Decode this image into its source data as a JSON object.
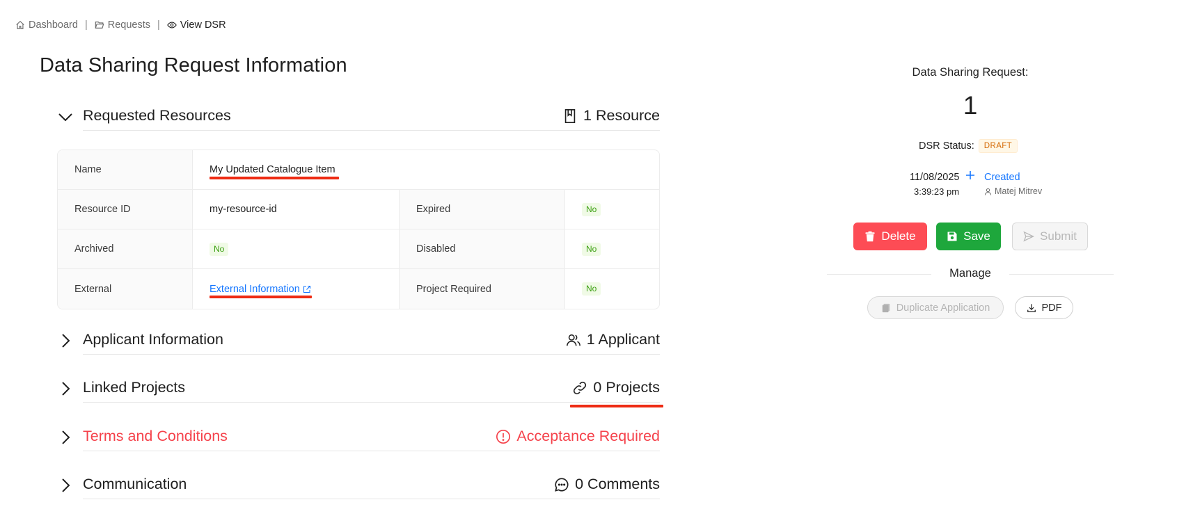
{
  "breadcrumb": {
    "items": [
      {
        "label": "Dashboard",
        "icon": "home-icon"
      },
      {
        "label": "Requests",
        "icon": "folder-open-icon"
      },
      {
        "label": "View DSR",
        "icon": "eye-icon"
      }
    ],
    "separator": "|"
  },
  "page_title": "Data Sharing Request Information",
  "sections": {
    "requested_resources": {
      "title": "Requested Resources",
      "summary": "1 Resource",
      "icon": "book-icon",
      "expanded": true
    },
    "applicant_information": {
      "title": "Applicant Information",
      "summary": "1 Applicant",
      "icon": "users-icon"
    },
    "linked_projects": {
      "title": "Linked Projects",
      "summary": "0 Projects",
      "icon": "link-icon"
    },
    "terms_and_conditions": {
      "title": "Terms and Conditions",
      "summary": "Acceptance Required",
      "icon": "exclamation-circle-icon",
      "color": "#f5424b"
    },
    "communication": {
      "title": "Communication",
      "summary": "0 Comments",
      "icon": "comment-icon"
    }
  },
  "resource_table": {
    "name_label": "Name",
    "name_value": "My Updated Catalogue Item",
    "resource_id_label": "Resource ID",
    "resource_id_value": "my-resource-id",
    "expired_label": "Expired",
    "expired_value": "No",
    "archived_label": "Archived",
    "archived_value": "No",
    "disabled_label": "Disabled",
    "disabled_value": "No",
    "external_label": "External",
    "external_link": "External Information",
    "project_required_label": "Project Required",
    "project_required_value": "No"
  },
  "panel": {
    "label": "Data Sharing Request:",
    "number": "1",
    "status_label": "DSR Status:",
    "status_value": "DRAFT",
    "date": "11/08/2025",
    "time": "3:39:23 pm",
    "event": "Created",
    "user": "Matej Mitrev",
    "buttons": {
      "delete": "Delete",
      "save": "Save",
      "submit": "Submit"
    },
    "manage_label": "Manage",
    "manage_buttons": {
      "duplicate": "Duplicate Application",
      "pdf": "PDF"
    }
  },
  "colors": {
    "accent": "#1677ff",
    "danger": "#fd4c55",
    "success": "#1ea73c",
    "draft": "#d46b08",
    "annotation": "#ee2b13"
  }
}
